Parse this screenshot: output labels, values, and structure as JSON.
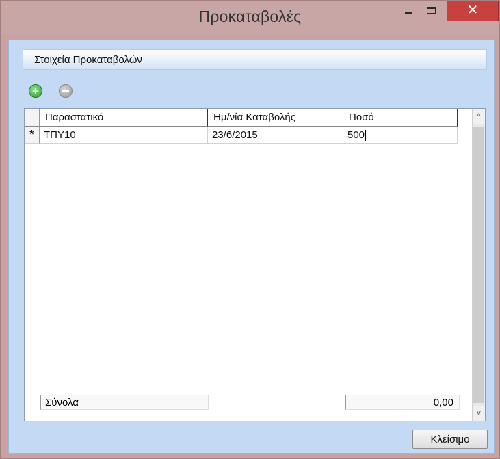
{
  "window": {
    "title": "Προκαταβολές",
    "close_glyph": "✕"
  },
  "group": {
    "header": "Στοιχεία Προκαταβολών"
  },
  "toolbar": {
    "add_icon": "plus-circle-icon",
    "remove_icon": "minus-circle-icon",
    "add_glyph": "+"
  },
  "grid": {
    "columns": [
      "Παραστατικό",
      "Ημ/νία Καταβολής",
      "Ποσό"
    ],
    "rows": [
      {
        "marker": "*",
        "document": "ΤΠΥ10",
        "date": "23/6/2015",
        "amount": "500"
      }
    ]
  },
  "totals": {
    "label": "Σύνολα",
    "value": "0,00"
  },
  "scrollbar": {
    "up_glyph": "^",
    "down_glyph": "v"
  },
  "footer": {
    "close_label": "Κλείσιμο"
  },
  "colors": {
    "titlebar": "#c9a6a6",
    "client": "#c3d9f4",
    "close_red": "#c7413e"
  }
}
